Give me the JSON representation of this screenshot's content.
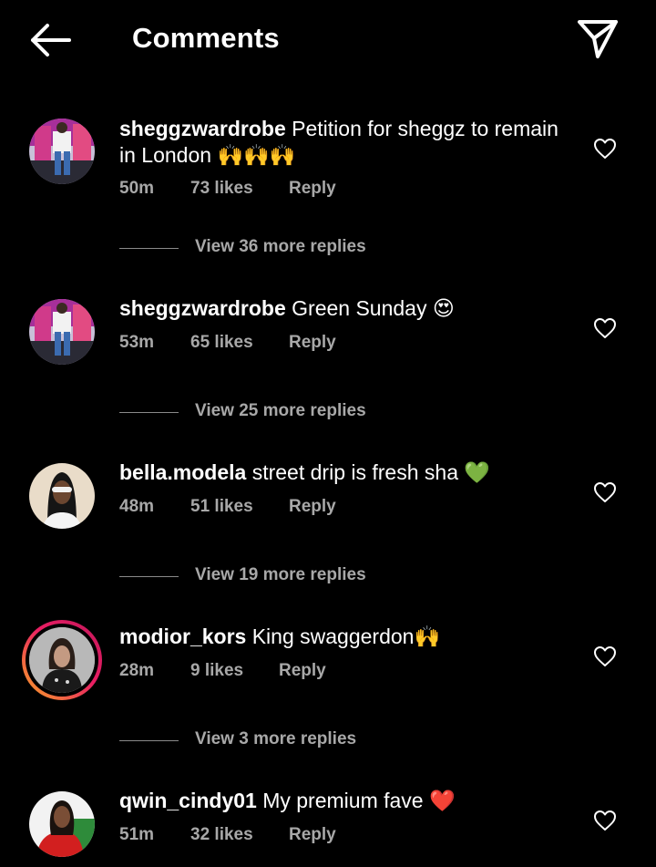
{
  "header": {
    "title": "Comments"
  },
  "comments": [
    {
      "username": "sheggzwardrobe",
      "text": "Petition for sheggz to remain in London",
      "emoji": "🙌🙌🙌",
      "time": "50m",
      "likes": "73 likes",
      "reply": "Reply",
      "view_replies": "View 36 more replies"
    },
    {
      "username": "sheggzwardrobe",
      "text": "Green Sunday",
      "emoji": "😍",
      "time": "53m",
      "likes": "65 likes",
      "reply": "Reply",
      "view_replies": "View 25 more replies"
    },
    {
      "username": "bella.modela",
      "text": "street drip is fresh sha",
      "emoji": "💚",
      "time": "48m",
      "likes": "51 likes",
      "reply": "Reply",
      "view_replies": "View 19 more replies"
    },
    {
      "username": "modior_kors",
      "text": "King swaggerdon",
      "emoji": "🙌",
      "time": "28m",
      "likes": "9 likes",
      "reply": "Reply",
      "view_replies": "View 3 more replies"
    },
    {
      "username": "qwin_cindy01",
      "text": "My premium fave",
      "emoji": "❤️",
      "time": "51m",
      "likes": "32 likes",
      "reply": "Reply"
    }
  ],
  "icons": {
    "back": "arrow-left-icon",
    "send": "paper-plane-icon",
    "like": "heart-outline-icon"
  },
  "colors": {
    "background": "#000000",
    "text": "#ffffff",
    "secondary_text": "#a8a8a8",
    "story_ring_start": "#f9a825",
    "story_ring_end": "#c2185b"
  }
}
